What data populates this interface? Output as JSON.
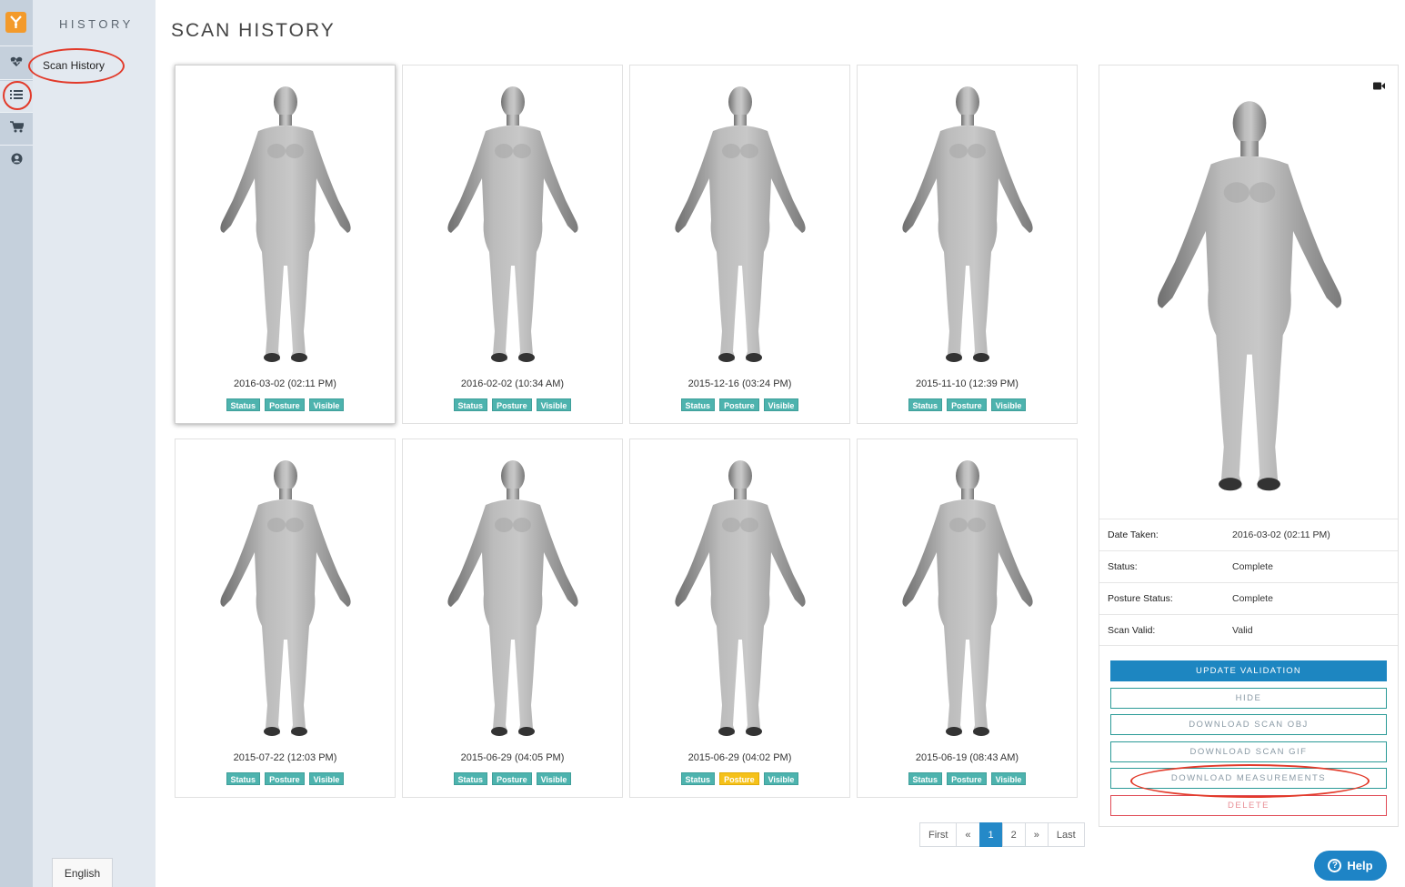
{
  "sidebar": {
    "section_title": "HISTORY",
    "link_label": "Scan History",
    "language_label": "English",
    "rail_icons": [
      "app-logo-icon",
      "heart-pulse-icon",
      "list-icon",
      "cart-icon",
      "user-icon"
    ]
  },
  "page": {
    "title": "SCAN HISTORY"
  },
  "scans": [
    {
      "date": "2016-03-02 (02:11 PM)",
      "badges": [
        "Status",
        "Posture",
        "Visible"
      ],
      "posture_warning": false,
      "selected": true
    },
    {
      "date": "2016-02-02 (10:34 AM)",
      "badges": [
        "Status",
        "Posture",
        "Visible"
      ],
      "posture_warning": false,
      "selected": false
    },
    {
      "date": "2015-12-16 (03:24 PM)",
      "badges": [
        "Status",
        "Posture",
        "Visible"
      ],
      "posture_warning": false,
      "selected": false
    },
    {
      "date": "2015-11-10 (12:39 PM)",
      "badges": [
        "Status",
        "Posture",
        "Visible"
      ],
      "posture_warning": false,
      "selected": false
    },
    {
      "date": "2015-07-22 (12:03 PM)",
      "badges": [
        "Status",
        "Posture",
        "Visible"
      ],
      "posture_warning": false,
      "selected": false
    },
    {
      "date": "2015-06-29 (04:05 PM)",
      "badges": [
        "Status",
        "Posture",
        "Visible"
      ],
      "posture_warning": false,
      "selected": false
    },
    {
      "date": "2015-06-29 (04:02 PM)",
      "badges": [
        "Status",
        "Posture",
        "Visible"
      ],
      "posture_warning": true,
      "selected": false
    },
    {
      "date": "2015-06-19 (08:43 AM)",
      "badges": [
        "Status",
        "Posture",
        "Visible"
      ],
      "posture_warning": false,
      "selected": false
    }
  ],
  "pagination": {
    "first": "First",
    "prev": "«",
    "pages": [
      "1",
      "2"
    ],
    "current": "1",
    "next": "»",
    "last": "Last"
  },
  "detail": {
    "rows": [
      {
        "label": "Date Taken:",
        "value": "2016-03-02 (02:11 PM)"
      },
      {
        "label": "Status:",
        "value": "Complete"
      },
      {
        "label": "Posture Status:",
        "value": "Complete"
      },
      {
        "label": "Scan Valid:",
        "value": "Valid"
      }
    ],
    "buttons": {
      "update_validation": "UPDATE VALIDATION",
      "hide": "HIDE",
      "download_obj": "DOWNLOAD SCAN OBJ",
      "download_gif": "DOWNLOAD SCAN GIF",
      "download_measurements": "DOWNLOAD MEASUREMENTS",
      "delete": "DELETE"
    }
  },
  "help": {
    "label": "Help",
    "glyph": "?"
  },
  "colors": {
    "badge": "#4db3ae",
    "badge_warning": "#f5c11a",
    "primary": "#1d86c1",
    "danger": "#e04a55",
    "annotation": "#e23a2a"
  }
}
